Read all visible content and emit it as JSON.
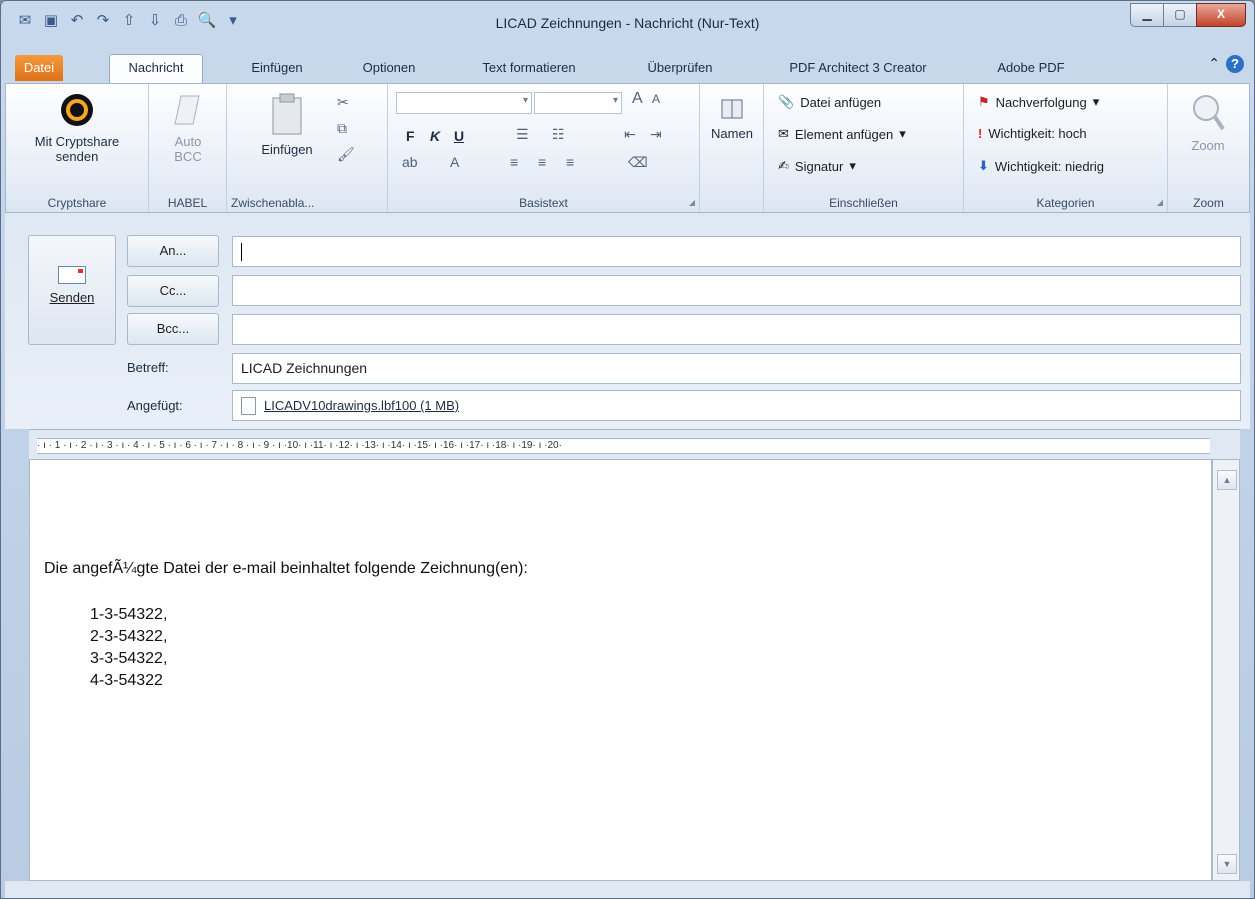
{
  "window": {
    "title": "LICAD Zeichnungen  -  Nachricht (Nur-Text)",
    "minimize": "▁",
    "maximize": "▢",
    "close": "X"
  },
  "tabs": [
    "Datei",
    "Nachricht",
    "Einfügen",
    "Optionen",
    "Text formatieren",
    "Überprüfen",
    "PDF Architect 3 Creator",
    "Adobe PDF"
  ],
  "ribbon": {
    "cryptshare": {
      "button": "Mit Cryptshare senden",
      "group": "Cryptshare"
    },
    "habel": {
      "button": "Auto BCC",
      "group": "HABEL"
    },
    "clipboard": {
      "button": "Einfügen",
      "group": "Zwischenabla..."
    },
    "basictext": {
      "group": "Basistext",
      "bold": "F",
      "italic": "K",
      "underline": "U",
      "grow": "A",
      "shrink": "A"
    },
    "names": {
      "button": "Namen"
    },
    "include": {
      "attach_file": "Datei anfügen",
      "attach_item": "Element anfügen",
      "signature": "Signatur",
      "group": "Einschließen"
    },
    "tags": {
      "followup": "Nachverfolgung",
      "high": "Wichtigkeit: hoch",
      "low": "Wichtigkeit: niedrig",
      "group": "Kategorien"
    },
    "zoom": {
      "button": "Zoom",
      "group": "Zoom"
    }
  },
  "header": {
    "send": "Senden",
    "to_button": "An...",
    "cc_button": "Cc...",
    "bcc_button": "Bcc...",
    "to_value": "",
    "cc_value": "",
    "bcc_value": "",
    "subject_label": "Betreff:",
    "subject_value": "LICAD Zeichnungen",
    "attached_label": "Angefügt:",
    "attachment": "LICADV10drawings.lbf100 (1 MB)"
  },
  "ruler": "· ı · 1 · ı · 2 · ı · 3 · ı · 4 · ı · 5 · ı · 6 · ı · 7 · ı · 8 · ı · 9 · ı ·10· ı ·11· ı ·12· ı ·13· ı ·14· ı ·15· ı ·16· ı ·17· ı ·18· ı ·19· ı ·20·",
  "body": {
    "intro": "Die angefÃ¼gte Datei der e-mail beinhaltet folgende Zeichnung(en):",
    "items": [
      "1-3-54322,",
      "2-3-54322,",
      "3-3-54322,",
      "4-3-54322"
    ]
  }
}
